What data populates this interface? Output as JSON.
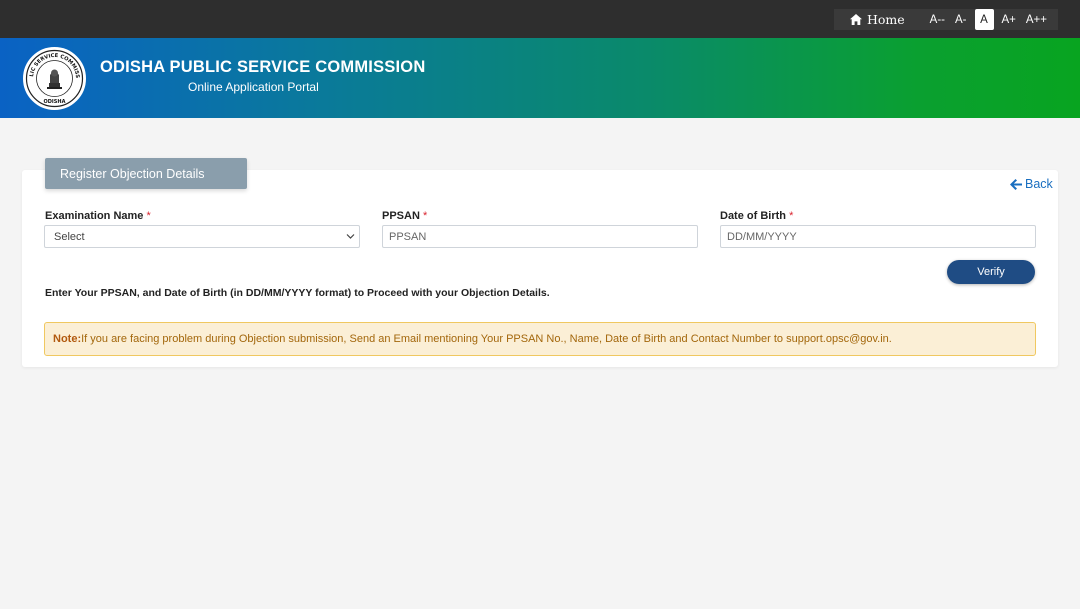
{
  "topbar": {
    "home_label": "Home",
    "font_sizes": [
      "A--",
      "A-",
      "A",
      "A+",
      "A++"
    ],
    "active_font_size": "A"
  },
  "header": {
    "title": "ODISHA PUBLIC SERVICE COMMISSION",
    "subtitle": "Online Application Portal",
    "logo_text": "PUBLIC SERVICE COMMISSION",
    "logo_bottom_text": "ODISHA",
    "gradient_start": "#0a62c4",
    "gradient_end": "#08a420"
  },
  "form": {
    "tab_label": "Register Objection Details",
    "back_label": "Back",
    "exam_name": {
      "label": "Examination Name",
      "required_mark": "*",
      "value": "Select"
    },
    "ppsan": {
      "label": "PPSAN",
      "required_mark": "*",
      "placeholder": "PPSAN"
    },
    "dob": {
      "label": "Date of Birth",
      "required_mark": "*",
      "placeholder": "DD/MM/YYYY"
    },
    "verify_label": "Verify",
    "instruction": "Enter Your PPSAN, and Date of Birth (in DD/MM/YYYY format) to Proceed with your Objection Details.",
    "note_label": "Note:",
    "note_text": "If you are facing problem during Objection submission, Send an Email mentioning Your PPSAN No., Name, Date of Birth and Contact Number to support.opsc@gov.in."
  },
  "colors": {
    "topbar": "#2e2e2e",
    "tab": "#8a9eac",
    "verify_button": "#1f4c84",
    "back_link": "#1a6fc0",
    "note_background": "#fbefd6",
    "note_text": "#a3670c",
    "required": "#d9232e"
  },
  "icons": {
    "home": "home-icon",
    "back": "arrow-left-icon",
    "select": "chevron-down-icon"
  }
}
